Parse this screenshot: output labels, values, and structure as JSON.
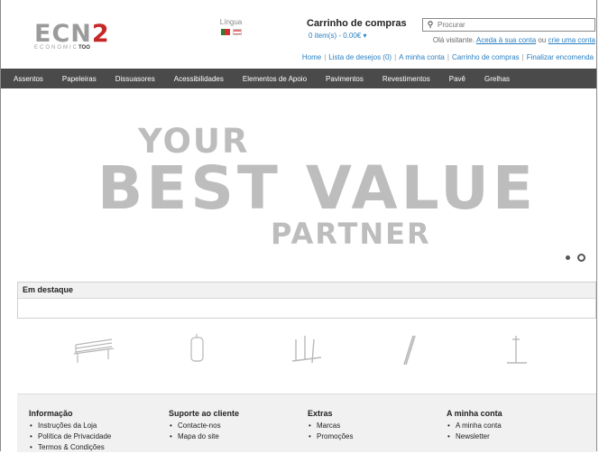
{
  "header": {
    "logo_main": "ECN",
    "logo_two": "2",
    "logo_sub": "ECONOMIC",
    "logo_sub_bold": "TOO",
    "language_label": "Língua",
    "cart_title": "Carrinho de compras",
    "cart_info": "0 item(s) - 0.00€ ▾",
    "search_placeholder": "Procurar",
    "welcome_text": "Olá visitante.",
    "welcome_login": "Aceda à sua conta",
    "welcome_or": "ou",
    "welcome_register": "crie uma conta"
  },
  "top_links": [
    "Home",
    "Lista de desejos (0)",
    "A minha conta",
    "Carrinho de compras",
    "Finalizar encomenda"
  ],
  "nav": [
    "Assentos",
    "Papeleiras",
    "Dissuasores",
    "Acessibilidades",
    "Elementos de Apoio",
    "Pavimentos",
    "Revestimentos",
    "Pavê",
    "Grelhas"
  ],
  "banner": {
    "line1": "YOUR",
    "line2": "BEST VALUE",
    "line3": "PARTNER"
  },
  "featured": {
    "title": "Em destaque"
  },
  "footer": [
    {
      "title": "Informação",
      "items": [
        "Instruções da Loja",
        "Política de Privacidade",
        "Termos & Condições"
      ]
    },
    {
      "title": "Suporte ao cliente",
      "items": [
        "Contacte-nos",
        "Mapa do site"
      ]
    },
    {
      "title": "Extras",
      "items": [
        "Marcas",
        "Promoções"
      ]
    },
    {
      "title": "A minha conta",
      "items": [
        "A minha conta",
        "Newsletter"
      ]
    }
  ],
  "colors": {
    "nav_bg": "#4a4a4a",
    "link": "#2a7fc0",
    "logo_red": "#c62828",
    "banner_text": "#bdbdbd"
  }
}
